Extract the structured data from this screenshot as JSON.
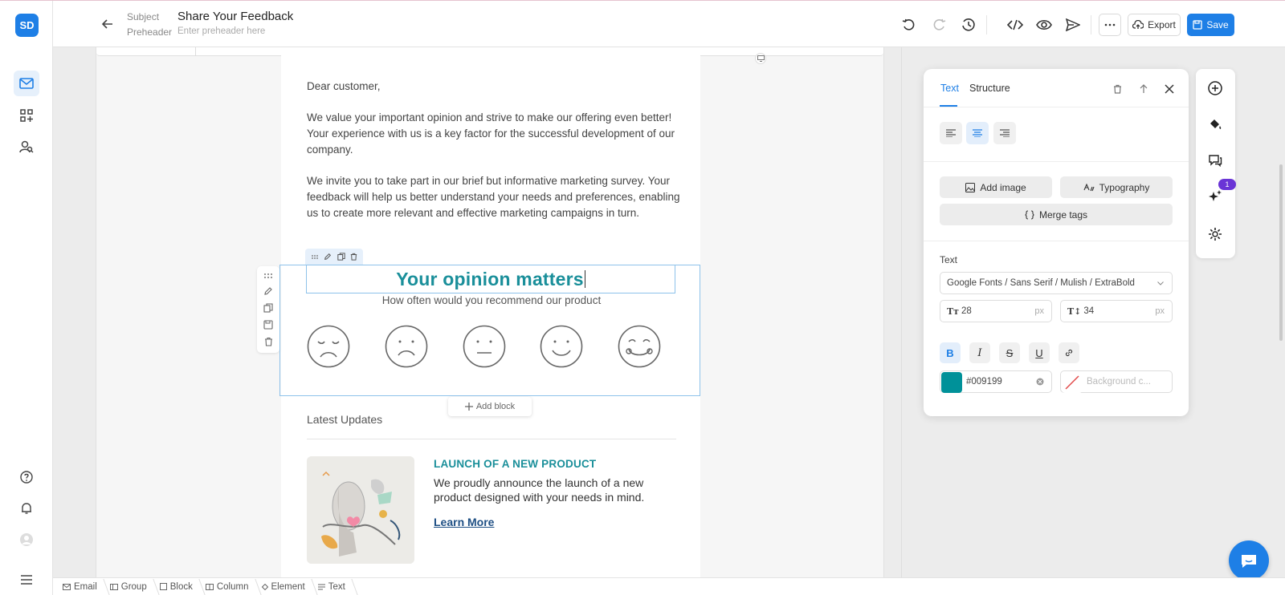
{
  "header": {
    "subject_label": "Subject",
    "subject_value": "Share Your Feedback",
    "preheader_label": "Preheader",
    "preheader_placeholder": "Enter preheader here",
    "export_label": "Export",
    "save_label": "Save"
  },
  "rail": {
    "avatar_initials": "SD"
  },
  "email": {
    "greeting": "Dear customer,",
    "para1": "We value your important opinion and strive to make our offering even better! Your experience with us is a key factor for the successful development of our company.",
    "para2": "We invite you to take part in our brief but informative marketing survey. Your feedback will help us better understand your needs and preferences, enabling us to create more relevant and effective marketing campaigns in turn.",
    "title": "Your opinion matters",
    "subtitle": "How often would you recommend our product",
    "add_block": "Add block",
    "latest_updates": "Latest Updates",
    "news_title": "LAUNCH OF A NEW PRODUCT",
    "news_text": "We proudly announce the launch of a new product designed with your needs in mind.",
    "news_link": "Learn More"
  },
  "panel": {
    "tab_text": "Text",
    "tab_structure": "Structure",
    "add_image": "Add image",
    "typography": "Typography",
    "merge_tags": "Merge tags",
    "text_label": "Text",
    "font_value": "Google Fonts / Sans Serif / Mulish / ExtraBold",
    "font_size": "28",
    "line_height": "34",
    "unit": "px",
    "color_value": "#009199",
    "bg_placeholder": "Background c..."
  },
  "icons_panel": {
    "badge_count": "1"
  },
  "breadcrumbs": [
    "Email",
    "Group",
    "Block",
    "Column",
    "Element",
    "Text"
  ],
  "colors": {
    "accent": "#1e7fe6",
    "brand_teal": "#009199",
    "badge": "#6a34d6"
  }
}
